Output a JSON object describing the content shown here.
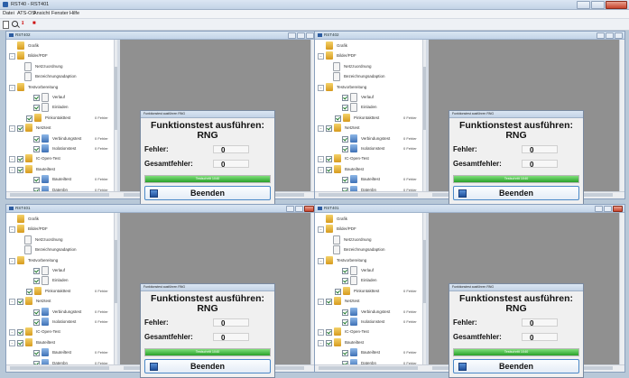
{
  "app": {
    "title": "RST40 - RST401",
    "menu": [
      "Datei",
      "ATS-OS",
      "Ansicht",
      "Fenster",
      "Hilfe"
    ]
  },
  "panels": [
    {
      "title": "RST402"
    },
    {
      "title": "RST402"
    },
    {
      "title": "RST401"
    },
    {
      "title": "RST401"
    }
  ],
  "tree": {
    "items": [
      {
        "label": "Grafik",
        "error": ""
      },
      {
        "label": "Bilder/PDF",
        "error": ""
      },
      {
        "label": "Netzzuordnung",
        "error": ""
      },
      {
        "label": "Bezeichnungsadaption",
        "error": ""
      },
      {
        "label": "Testvorbereitung",
        "error": ""
      },
      {
        "label": "Verlauf",
        "error": ""
      },
      {
        "label": "Einladen",
        "error": ""
      },
      {
        "label": "Pinkontakttest",
        "error": "0 Fehler"
      },
      {
        "label": "Netztest",
        "error": ""
      },
      {
        "label": "Verbindungstest",
        "error": "0 Fehler"
      },
      {
        "label": "Isolationstest",
        "error": "0 Fehler"
      },
      {
        "label": "IC-Open-Test",
        "error": ""
      },
      {
        "label": "Bauteiltest",
        "error": ""
      },
      {
        "label": "Bauteiltest",
        "error": "0 Fehler"
      },
      {
        "label": "Datenbn",
        "error": "0 Fehler"
      }
    ]
  },
  "dialog": {
    "window_title": "Funktionstest ausführen RNG",
    "heading_line1": "Funktionstest ausführen:",
    "heading_line2": "RNG",
    "error_label": "Fehler:",
    "error_value": "0",
    "total_label": "Gesamtfehler:",
    "total_value": "0",
    "progress_text": "Testschritt 1040",
    "progress_fraction": 1.0,
    "button_label": "Beenden"
  },
  "colors": {
    "accent": "#4b89c8",
    "progress": "#2aa02a",
    "workspace_gray": "#909090"
  }
}
